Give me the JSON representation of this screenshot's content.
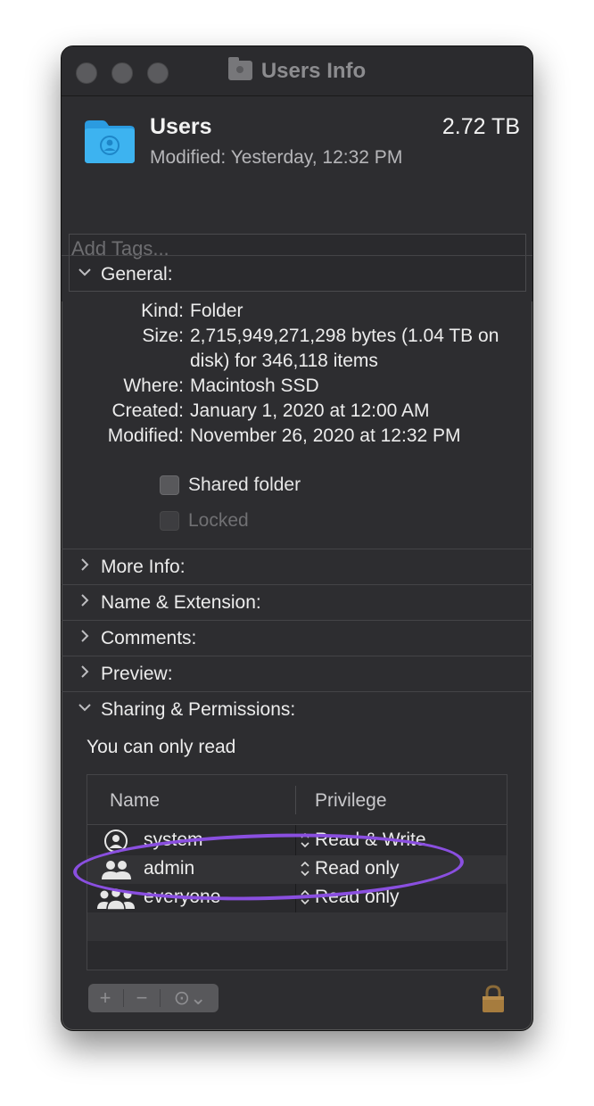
{
  "window": {
    "title": "Users Info"
  },
  "header": {
    "name": "Users",
    "size": "2.72 TB",
    "modified_label": "Modified:",
    "modified_value": "Yesterday, 12:32 PM",
    "tags_placeholder": "Add Tags..."
  },
  "general": {
    "title": "General:",
    "rows": [
      {
        "key": "Kind:",
        "value": "Folder"
      },
      {
        "key": "Size:",
        "value": "2,715,949,271,298 bytes (1.04 TB on disk) for 346,118 items"
      },
      {
        "key": "Where:",
        "value": "Macintosh SSD"
      },
      {
        "key": "Created:",
        "value": "January 1, 2020 at 12:00 AM"
      },
      {
        "key": "Modified:",
        "value": "November 26, 2020 at 12:32 PM"
      }
    ],
    "shared_folder": {
      "label": "Shared folder",
      "checked": false
    },
    "locked": {
      "label": "Locked",
      "checked": false,
      "disabled": true
    }
  },
  "sections": {
    "more_info": "More Info:",
    "name_ext": "Name & Extension:",
    "comments": "Comments:",
    "preview": "Preview:",
    "sharing": "Sharing & Permissions:"
  },
  "sharing": {
    "note": "You can only read",
    "columns": {
      "name": "Name",
      "privilege": "Privilege"
    },
    "rows": [
      {
        "name": "system",
        "privilege": "Read & Write",
        "icon": "user-icon"
      },
      {
        "name": "admin",
        "privilege": "Read only",
        "icon": "group-icon"
      },
      {
        "name": "everyone",
        "privilege": "Read only",
        "icon": "everyone-icon"
      }
    ]
  },
  "toolbar": {
    "add": "+",
    "remove": "−",
    "action": "⊙⌄"
  },
  "colors": {
    "window_bg": "#2d2d30",
    "accent_folder": "#2fa6e6",
    "highlight_oval": "#8a4fe0",
    "lock": "#a67c3e"
  }
}
